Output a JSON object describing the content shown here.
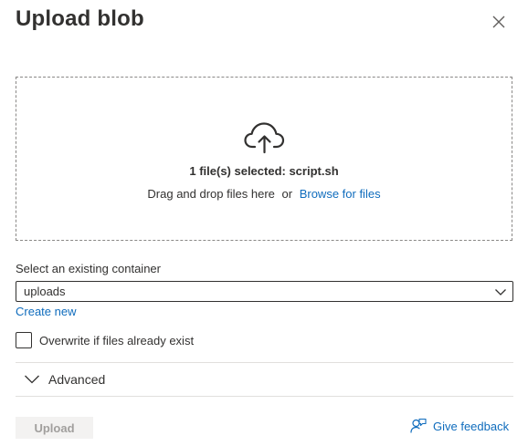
{
  "panel": {
    "title": "Upload blob",
    "close_icon": "close-icon"
  },
  "dropzone": {
    "icon": "cloud-upload-icon",
    "selected_text": "1 file(s) selected: script.sh",
    "drag_text": "Drag and drop files here",
    "or_text": "or",
    "browse_link": "Browse for files"
  },
  "container": {
    "label": "Select an existing container",
    "selected_value": "uploads",
    "create_new": "Create new"
  },
  "overwrite": {
    "label": "Overwrite if files already exist",
    "checked": false
  },
  "advanced": {
    "label": "Advanced",
    "expanded": false
  },
  "footer": {
    "upload_label": "Upload",
    "upload_enabled": false,
    "feedback_label": "Give feedback",
    "feedback_icon": "feedback-person-icon"
  },
  "colors": {
    "link": "#0f6cbd",
    "text": "#323130",
    "border": "#8a8886",
    "disabled_bg": "#f3f2f1",
    "disabled_text": "#a19f9d"
  }
}
